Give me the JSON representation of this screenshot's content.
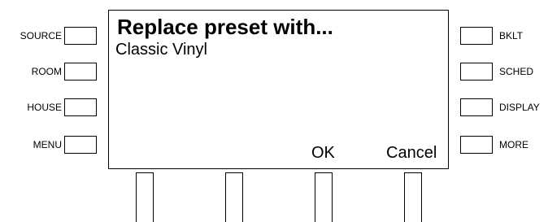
{
  "left_buttons": [
    {
      "label": "SOURCE"
    },
    {
      "label": "ROOM"
    },
    {
      "label": "HOUSE"
    },
    {
      "label": "MENU"
    }
  ],
  "right_buttons": [
    {
      "label": "BKLT"
    },
    {
      "label": "SCHED"
    },
    {
      "label": "DISPLAY"
    },
    {
      "label": "MORE"
    }
  ],
  "screen": {
    "title": "Replace preset with...",
    "subtitle": "Classic Vinyl",
    "softkeys": {
      "ok": "OK",
      "cancel": "Cancel"
    }
  }
}
